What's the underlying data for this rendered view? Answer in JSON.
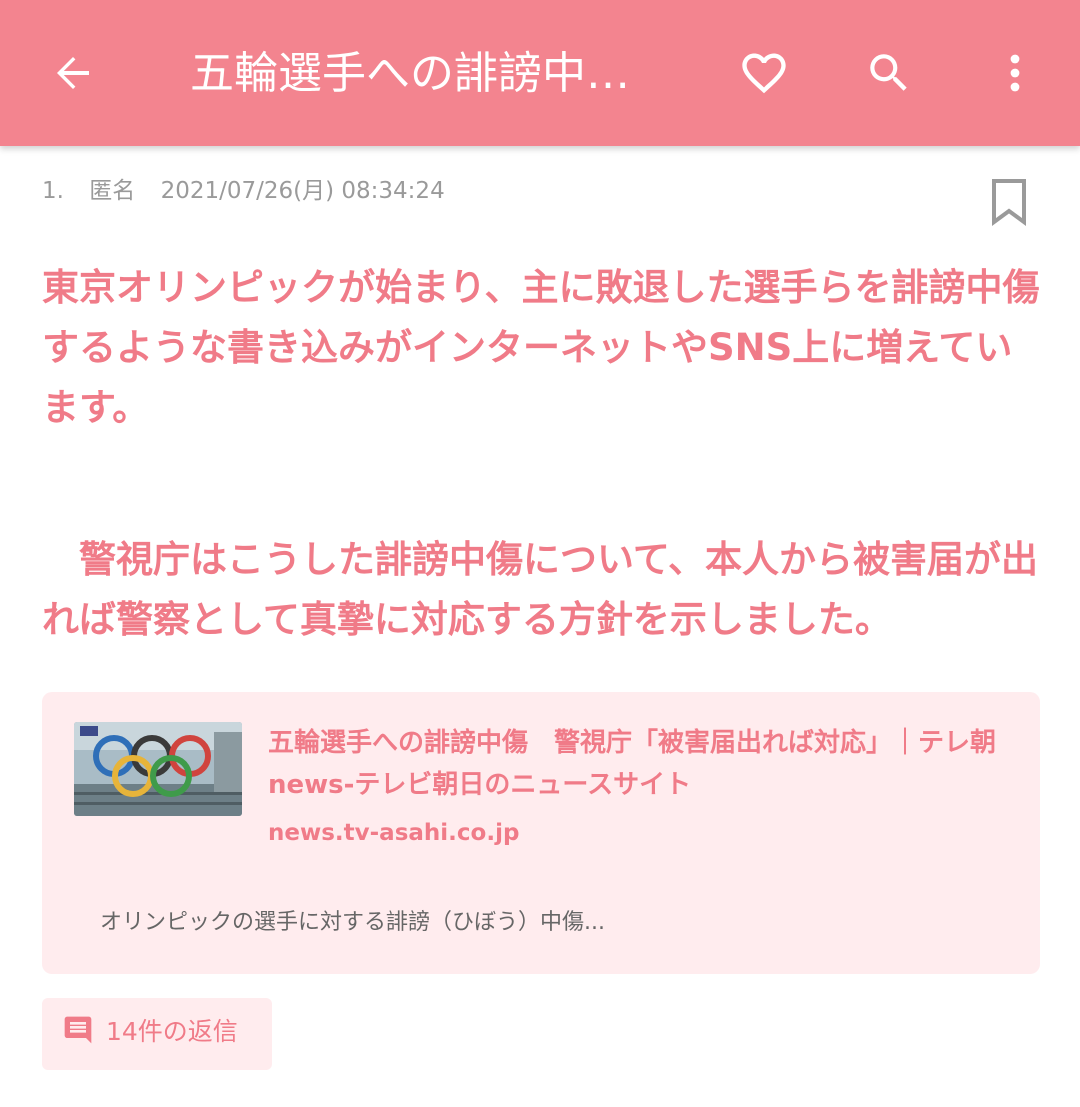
{
  "appbar": {
    "title": "五輪選手への誹謗中…",
    "icons": {
      "back": "arrow-back-icon",
      "favorite": "heart-outline-icon",
      "search": "search-icon",
      "more": "more-vertical-icon"
    },
    "color": "#f3848f"
  },
  "post": {
    "number": "1.",
    "author": "匿名",
    "datetime": "2021/07/26(月) 08:34:24",
    "bookmark_icon": "bookmark-outline-icon",
    "paragraphs": [
      "東京オリンピックが始まり、主に敗退した選手らを誹謗中傷するような書き込みがインターネットやSNS上に増えています。",
      "警視庁はこうした誹謗中傷について、本人から被害届が出れば警察として真摯に対応する方針を示しました。"
    ],
    "text_color": "#f07b88"
  },
  "link_card": {
    "title": "五輪選手への誹謗中傷　警視庁「被害届出れば対応」｜テレ朝news-テレビ朝日のニュースサイト",
    "domain": "news.tv-asahi.co.jp",
    "description": "オリンピックの選手に対する誹謗（ひぼう）中傷...",
    "thumbnail": "olympic-rings-image",
    "background": "#ffecee"
  },
  "replies": {
    "icon": "comment-icon",
    "label": "14件の返信"
  }
}
